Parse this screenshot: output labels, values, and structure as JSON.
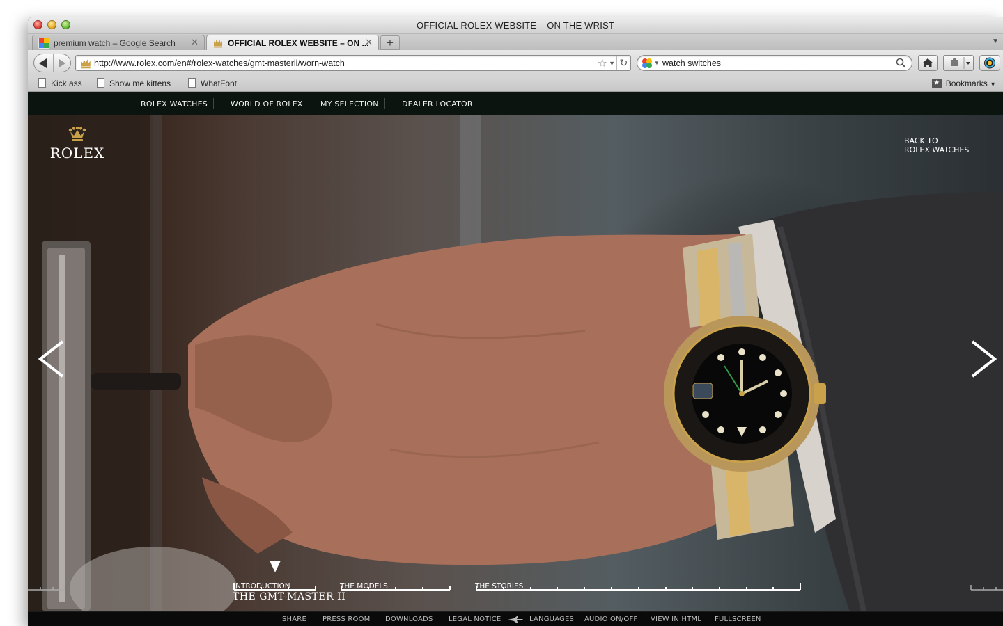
{
  "browser": {
    "window_title": "OFFICIAL ROLEX WEBSITE – ON THE WRIST",
    "tabs": [
      {
        "label": "premium watch – Google Search",
        "favicon": "google-icon",
        "active": false
      },
      {
        "label": "OFFICIAL ROLEX WEBSITE – ON ...",
        "favicon": "rolex-crown-icon",
        "active": true
      }
    ],
    "new_tab_label": "+",
    "url": "http://www.rolex.com/en#/rolex-watches/gmt-masterii/worn-watch",
    "search_value": "watch switches",
    "bookmarks": [
      "Kick ass",
      "Show me kittens",
      "WhatFont"
    ],
    "bookmarks_menu": "Bookmarks"
  },
  "site": {
    "brand": "ROLEX",
    "colors": {
      "gold": "#c9a14a",
      "nav_bg": "#0b140f"
    },
    "top_nav": [
      "ROLEX WATCHES",
      "WORLD OF ROLEX",
      "MY SELECTION",
      "DEALER LOCATOR"
    ],
    "back_link": {
      "line1": "BACK TO",
      "line2": "ROLEX WATCHES"
    },
    "timeline": {
      "sections": [
        "INTRODUCTION",
        "THE MODELS",
        "THE STORIES"
      ],
      "current_title": "THE GMT-MASTER II"
    },
    "footer": [
      "SHARE",
      "PRESS ROOM",
      "DOWNLOADS",
      "LEGAL NOTICE",
      "LANGUAGES",
      "AUDIO ON/OFF",
      "VIEW IN HTML",
      "FULLSCREEN"
    ]
  }
}
